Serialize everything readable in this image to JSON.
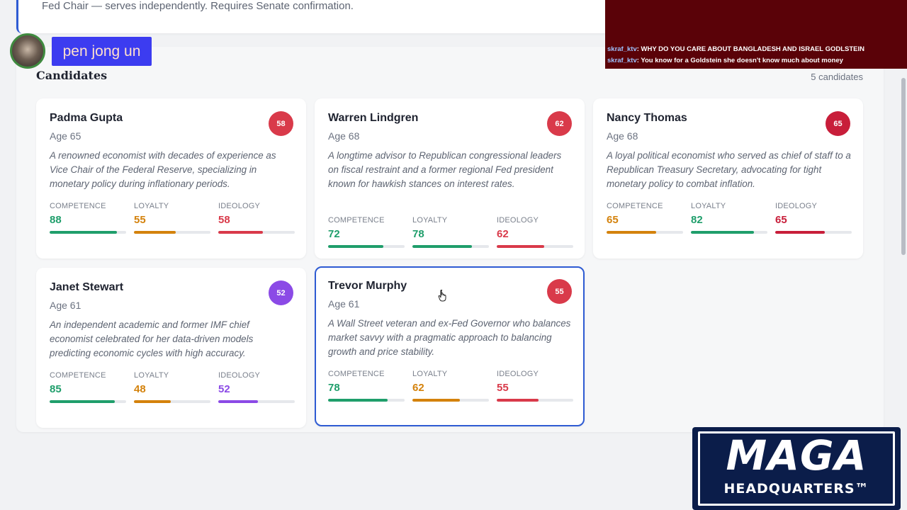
{
  "top_card": {
    "description": "Fed Chair — serves independently. Requires Senate confirmation."
  },
  "candidates_panel": {
    "title": "Candidates",
    "count": "5 candidates"
  },
  "stat_labels": {
    "competence": "COMPETENCE",
    "loyalty": "LOYALTY",
    "ideology": "IDEOLOGY"
  },
  "colors": {
    "green": "#1f9e6b",
    "orange": "#d4820c",
    "red": "#d93a4a",
    "crimson": "#c81e3a",
    "purple": "#8b4ae6",
    "blue": "#2e5bd3"
  },
  "candidates": [
    {
      "name": "Padma Gupta",
      "age": "Age 65",
      "score": "58",
      "score_color": "#d93a4a",
      "bio": "A renowned economist with decades of experience as Vice Chair of the Federal Reserve, specializing in monetary policy during inflationary periods.",
      "competence": "88",
      "loyalty": "55",
      "ideology": "58",
      "competence_color": "#1f9e6b",
      "loyalty_color": "#d4820c",
      "ideology_color": "#d93a4a"
    },
    {
      "name": "Warren Lindgren",
      "age": "Age 68",
      "score": "62",
      "score_color": "#d93a4a",
      "bio": "A longtime advisor to Republican congressional leaders on fiscal restraint and a former regional Fed president known for hawkish stances on interest rates.",
      "competence": "72",
      "loyalty": "78",
      "ideology": "62",
      "competence_color": "#1f9e6b",
      "loyalty_color": "#1f9e6b",
      "ideology_color": "#d93a4a"
    },
    {
      "name": "Nancy Thomas",
      "age": "Age 68",
      "score": "65",
      "score_color": "#c81e3a",
      "bio": "A loyal political economist who served as chief of staff to a Republican Treasury Secretary, advocating for tight monetary policy to combat inflation.",
      "competence": "65",
      "loyalty": "82",
      "ideology": "65",
      "competence_color": "#d4820c",
      "loyalty_color": "#1f9e6b",
      "ideology_color": "#c81e3a"
    },
    {
      "name": "Janet Stewart",
      "age": "Age 61",
      "score": "52",
      "score_color": "#8b4ae6",
      "bio": "An independent academic and former IMF chief economist celebrated for her data-driven models predicting economic cycles with high accuracy.",
      "competence": "85",
      "loyalty": "48",
      "ideology": "52",
      "competence_color": "#1f9e6b",
      "loyalty_color": "#d4820c",
      "ideology_color": "#8b4ae6"
    },
    {
      "name": "Trevor Murphy",
      "age": "Age 61",
      "score": "55",
      "score_color": "#d93a4a",
      "bio": "A Wall Street veteran and ex-Fed Governor who balances market savvy with a pragmatic approach to balancing growth and price stability.",
      "competence": "78",
      "loyalty": "62",
      "ideology": "55",
      "competence_color": "#1f9e6b",
      "loyalty_color": "#d4820c",
      "ideology_color": "#d93a4a"
    }
  ],
  "overlays": {
    "streamer_name": "pen jong un",
    "chat": [
      {
        "user": "skraf_ktv",
        "message": "WHY DO YOU CARE ABOUT BANGLADESH AND ISRAEL GODLSTEIN"
      },
      {
        "user": "skraf_ktv",
        "message": "You know for a Goldstein she doesn't know much about money"
      }
    ],
    "logo_big": "MAGA",
    "logo_small": "HEADQUARTERS™"
  }
}
